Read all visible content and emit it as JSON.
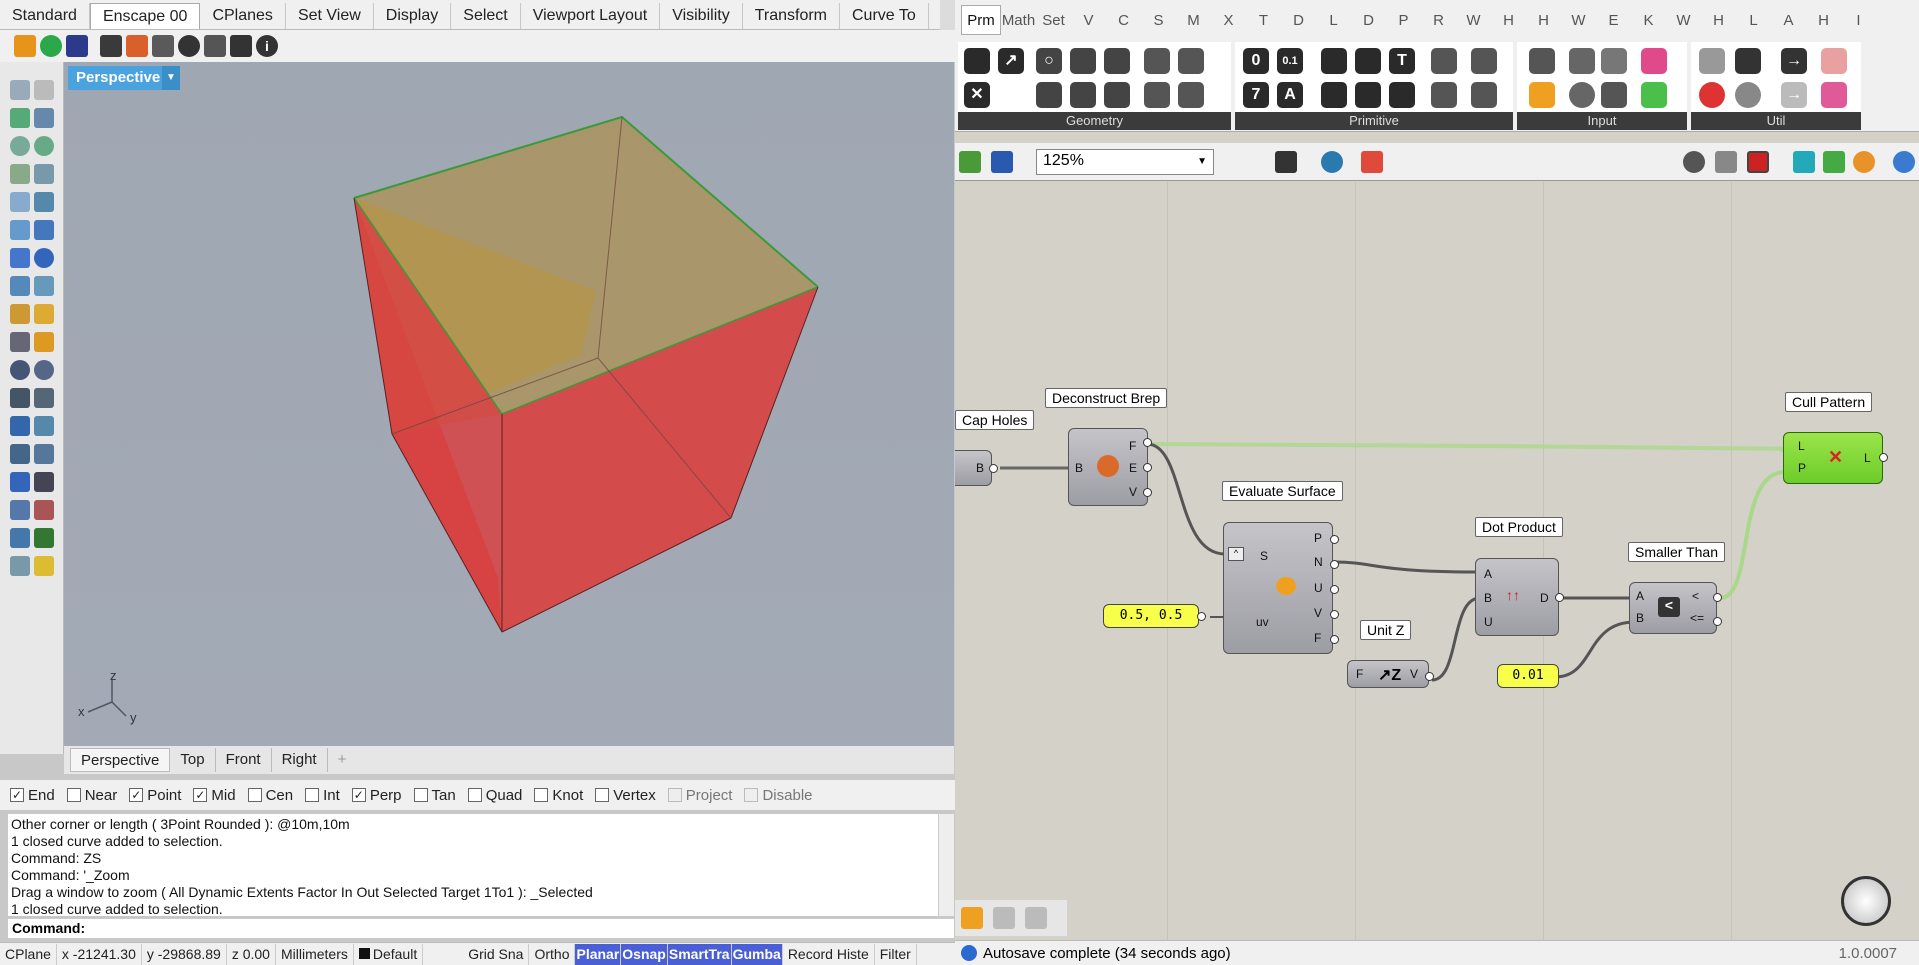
{
  "rhino": {
    "toolbar_tabs": [
      "Standard",
      "Enscape 00",
      "CPlanes",
      "Set View",
      "Display",
      "Select",
      "Viewport Layout",
      "Visibility",
      "Transform",
      "Curve To"
    ],
    "active_tab": "Enscape 00",
    "viewport": {
      "title": "Perspective",
      "tabs": [
        "Perspective",
        "Top",
        "Front",
        "Right"
      ],
      "axis": {
        "z": "z",
        "x": "x",
        "y": "y"
      }
    },
    "osnaps": [
      {
        "label": "End",
        "checked": true
      },
      {
        "label": "Near",
        "checked": false
      },
      {
        "label": "Point",
        "checked": true
      },
      {
        "label": "Mid",
        "checked": true
      },
      {
        "label": "Cen",
        "checked": false
      },
      {
        "label": "Int",
        "checked": false
      },
      {
        "label": "Perp",
        "checked": true
      },
      {
        "label": "Tan",
        "checked": false
      },
      {
        "label": "Quad",
        "checked": false
      },
      {
        "label": "Knot",
        "checked": false
      },
      {
        "label": "Vertex",
        "checked": false
      },
      {
        "label": "Project",
        "checked": false,
        "disabled": true
      },
      {
        "label": "Disable",
        "checked": false,
        "disabled": true
      }
    ],
    "command_history": [
      "Other corner or length ( 3Point  Rounded ): @10m,10m",
      "1 closed curve added to selection.",
      "Command: ZS",
      "Command: '_Zoom",
      "Drag a window to zoom ( All  Dynamic  Extents  Factor  In  Out  Selected  Target  1To1 ): _Selected",
      "1 closed curve added to selection."
    ],
    "command_prompt": "Command:",
    "status": {
      "cplane": "CPlane",
      "x": "x -21241.30",
      "y": "y -29868.89",
      "z": "z 0.00",
      "units": "Millimeters",
      "layer": "Default",
      "toggles": [
        {
          "label": "Grid Sna",
          "on": false
        },
        {
          "label": "Ortho",
          "on": false
        },
        {
          "label": "Planar",
          "on": true
        },
        {
          "label": "Osnap",
          "on": true
        },
        {
          "label": "SmartTra",
          "on": true
        },
        {
          "label": "Gumba",
          "on": true
        },
        {
          "label": "Record Histe",
          "on": false
        },
        {
          "label": "Filter",
          "on": false
        }
      ]
    }
  },
  "grasshopper": {
    "tabs": [
      "Prm",
      "Math",
      "Set",
      "V",
      "C",
      "S",
      "M",
      "X",
      "T",
      "D",
      "L",
      "D",
      "P",
      "R",
      "W",
      "H",
      "H",
      "W",
      "E",
      "K",
      "W",
      "H",
      "L",
      "A",
      "H",
      "I"
    ],
    "active_tab": "Prm",
    "ribbon_groups": [
      "Geometry",
      "Primitive",
      "Input",
      "Util"
    ],
    "zoom": "125%",
    "components": {
      "cap_holes": {
        "label": "Cap Holes",
        "out": "B"
      },
      "deconstruct_brep": {
        "label": "Deconstruct Brep",
        "in": "B",
        "outs": [
          "F",
          "E",
          "V"
        ]
      },
      "evaluate_surface": {
        "label": "Evaluate Surface",
        "ins": [
          "S",
          "uv"
        ],
        "outs": [
          "P",
          "N",
          "U",
          "V",
          "F"
        ]
      },
      "uv_panel": {
        "value": "0.5, 0.5"
      },
      "unit_z": {
        "label": "Unit Z",
        "in": "F",
        "out": "V"
      },
      "dot_product": {
        "label": "Dot Product",
        "ins": [
          "A",
          "B",
          "U"
        ],
        "out": "D"
      },
      "tolerance_panel": {
        "value": "0.01"
      },
      "smaller_than": {
        "label": "Smaller Than",
        "ins": [
          "A",
          "B"
        ],
        "outs": [
          "<",
          "<="
        ]
      },
      "cull_pattern": {
        "label": "Cull Pattern",
        "ins": [
          "L",
          "P"
        ],
        "out": "L"
      }
    },
    "status": "Autosave complete (34 seconds ago)",
    "version": "1.0.0007"
  }
}
